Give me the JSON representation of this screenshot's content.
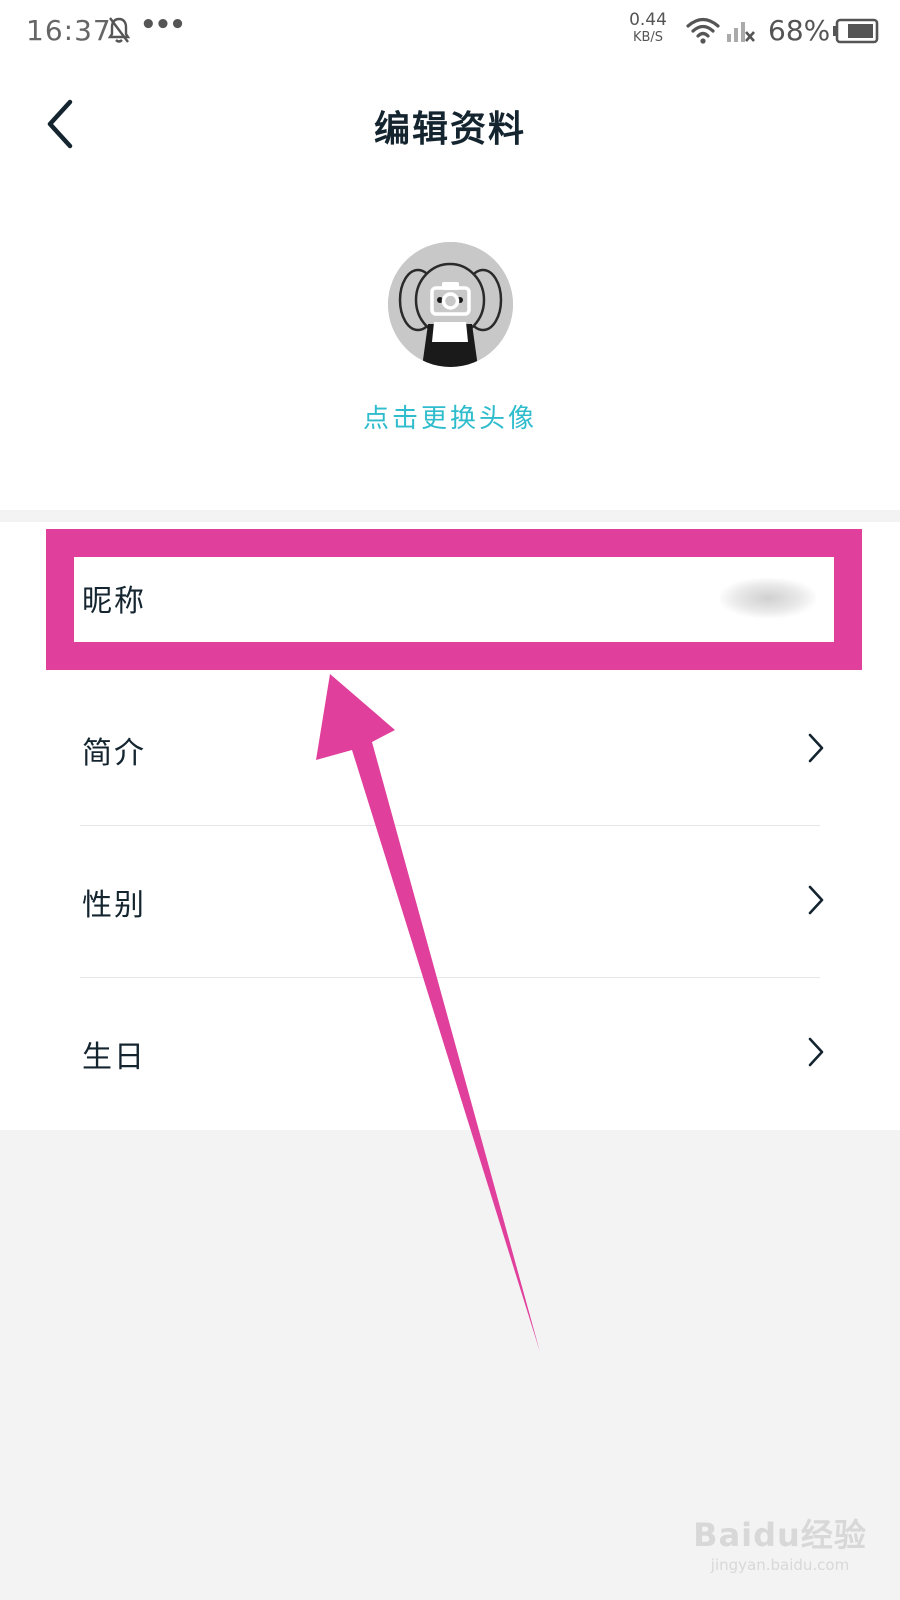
{
  "status_bar": {
    "time": "16:37",
    "net_speed_value": "0.44",
    "net_speed_unit": "KB/S",
    "battery_percent": "68%",
    "icons": [
      "bell-muted-icon",
      "more-dots-icon",
      "wifi-icon",
      "signal-no-service-icon",
      "battery-icon"
    ]
  },
  "header": {
    "title": "编辑资料",
    "back_icon": "chevron-left-icon"
  },
  "avatar": {
    "caption": "点击更换头像",
    "overlay_icon": "camera-icon"
  },
  "profile_fields": [
    {
      "label": "昵称",
      "value_blurred": true
    },
    {
      "label": "简介",
      "chevron_icon": "chevron-right-icon"
    },
    {
      "label": "性别",
      "chevron_icon": "chevron-right-icon"
    },
    {
      "label": "生日",
      "chevron_icon": "chevron-right-icon"
    }
  ],
  "annotation": {
    "highlight_color": "#e03f9c"
  },
  "watermark": {
    "logo": "Baidu经验",
    "url": "jingyan.baidu.com"
  },
  "colors": {
    "accent": "#2fbccd",
    "text_primary": "#142530",
    "page_background": "#f3f3f3",
    "annotation": "#e03f9c"
  }
}
